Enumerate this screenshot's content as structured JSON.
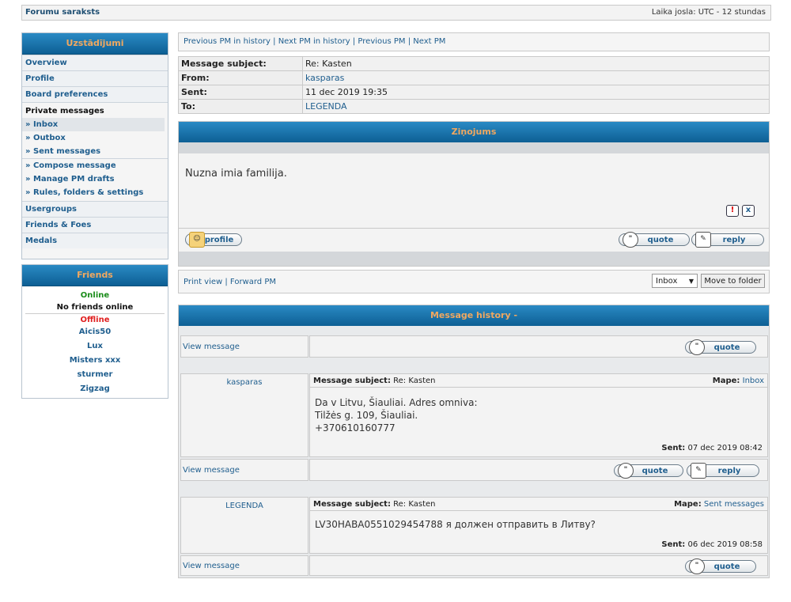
{
  "topbar": {
    "left": "Forumu saraksts",
    "right": "Laika josla: UTC - 12 stundas"
  },
  "sidebar": {
    "title": "Uzstādījumi",
    "items": [
      "Overview",
      "Profile",
      "Board preferences"
    ],
    "pm_label": "Private messages",
    "pm_items": [
      "» Inbox",
      "» Outbox",
      "» Sent messages"
    ],
    "pm_items2": [
      "» Compose message",
      "» Manage PM drafts",
      "» Rules, folders & settings"
    ],
    "items2": [
      "Usergroups",
      "Friends & Foes",
      "Medals"
    ]
  },
  "friends": {
    "title": "Friends",
    "online_label": "Online",
    "no_online": "No friends online",
    "offline_label": "Offline",
    "offline": [
      "Aicis50",
      "Lux",
      "Misters xxx",
      "sturmer",
      "Zigzag"
    ],
    "colors": {
      "online": "#1a8c1a",
      "offline": "#e02020"
    }
  },
  "pmnav": {
    "links": "Previous PM in history | Next PM in history | Previous PM | Next PM"
  },
  "message": {
    "subject_label": "Message subject:",
    "subject": "Re: Kasten",
    "from_label": "From:",
    "from": "kasparas",
    "sent_label": "Sent:",
    "sent": "11 dec 2019 19:35",
    "to_label": "To:",
    "to": "LEGENDA",
    "header": "Ziņojums",
    "body": "Nuzna imia familija."
  },
  "buttons": {
    "profile": "profile",
    "quote": "quote",
    "reply": "reply",
    "report": "!",
    "delete": "x"
  },
  "actions": {
    "links": "Print view | Forward PM",
    "folder_select": "Inbox",
    "move_button": "Move to folder"
  },
  "history": {
    "header": "Message history -",
    "view_message": "View message",
    "subject_label": "Message subject:",
    "folder_label": "Mape:",
    "sent_label": "Sent:",
    "entries": [
      {
        "author": "kasparas",
        "subject": "Re: Kasten",
        "folder": "Inbox",
        "lines": [
          "Da v Litvu, Šiauliai. Adres omniva:",
          "Tilžės g. 109, Šiauliai.",
          "+370610160777"
        ],
        "sent": "07 dec 2019 08:42"
      },
      {
        "author": "LEGENDA",
        "subject": "Re: Kasten",
        "folder": "Sent messages",
        "lines": [
          "LV30HABA0551029454788 я должен отправить в Литву?"
        ],
        "sent": "06 dec 2019 08:58"
      }
    ]
  }
}
